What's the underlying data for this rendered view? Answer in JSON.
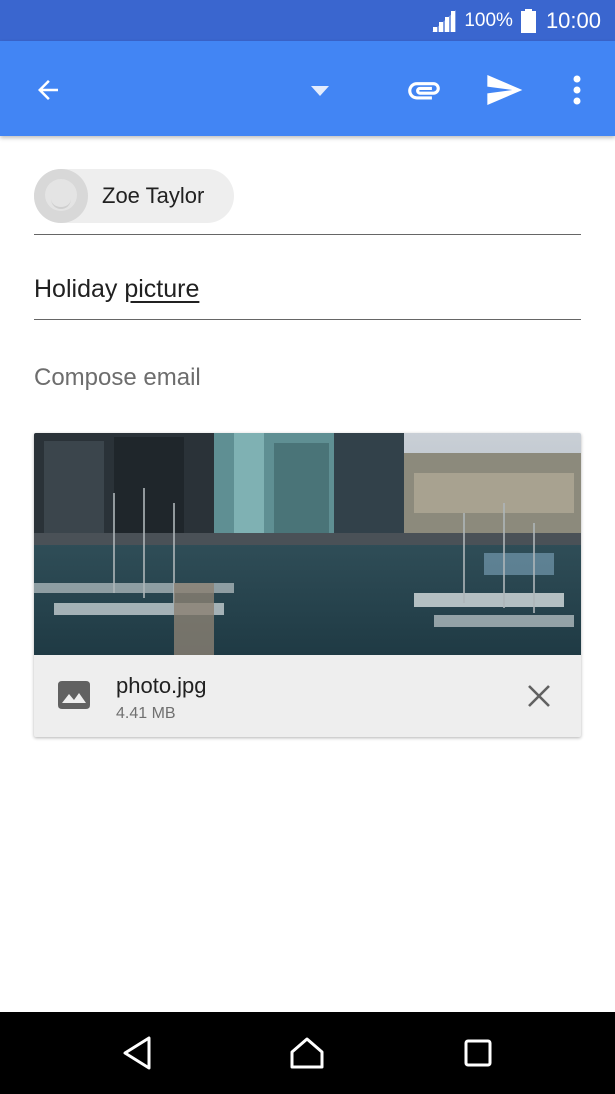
{
  "status_bar": {
    "battery_percent": "100%",
    "time": "10:00",
    "signal_icon": "cell-signal-icon",
    "battery_icon": "battery-full-icon"
  },
  "toolbar": {
    "icons": [
      "back-arrow-icon",
      "dropdown-arrow-icon",
      "paperclip-icon",
      "send-icon",
      "more-vert-icon"
    ]
  },
  "recipient": {
    "name": "Zoe Taylor"
  },
  "subject": {
    "word1": "Holiday",
    "word2": "picture"
  },
  "body": {
    "placeholder": "Compose email"
  },
  "attachment": {
    "filename": "photo.jpg",
    "size": "4.41 MB",
    "icon": "image-file-icon",
    "remove_icon": "close-icon"
  },
  "nav_bar": {
    "icons": [
      "nav-back-icon",
      "nav-home-icon",
      "nav-recents-icon"
    ]
  },
  "colors": {
    "status_bar": "#3a66cf",
    "app_bar": "#4285f4",
    "card": "#eeeeee"
  }
}
